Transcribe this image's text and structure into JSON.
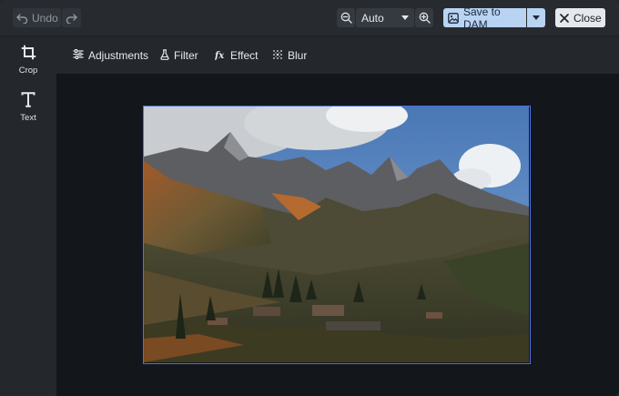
{
  "toolbar": {
    "undo_label": "Undo",
    "zoom_value": "Auto",
    "save_label": "Save to DAM",
    "close_label": "Close"
  },
  "tools": [
    {
      "label": "Crop",
      "icon": "crop-icon"
    },
    {
      "label": "Text",
      "icon": "text-icon"
    }
  ],
  "subtools": [
    {
      "label": "Adjustments",
      "icon": "sliders-icon"
    },
    {
      "label": "Filter",
      "icon": "flask-icon"
    },
    {
      "label": "Effect",
      "icon": "fx-icon"
    },
    {
      "label": "Blur",
      "icon": "blur-grid-icon"
    }
  ],
  "colors": {
    "accent": "#4d6fe6",
    "save_button": "#b9d3f3",
    "background": "#24282d",
    "canvas": "#13171b"
  }
}
